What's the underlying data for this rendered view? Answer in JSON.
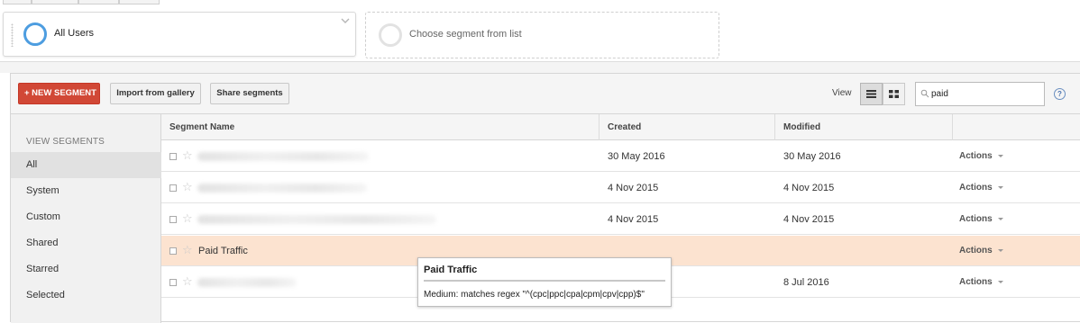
{
  "segments_bar": {
    "selected_segment": "All Users",
    "empty_slot_text": "Choose segment from list"
  },
  "toolbar": {
    "new_segment_label": "+ NEW SEGMENT",
    "import_label": "Import from gallery",
    "share_label": "Share segments",
    "view_label": "View",
    "search_value": "paid",
    "help_label": "?"
  },
  "sidebar": {
    "heading": "VIEW SEGMENTS",
    "items": [
      {
        "label": "All",
        "active": true
      },
      {
        "label": "System"
      },
      {
        "label": "Custom"
      },
      {
        "label": "Shared"
      },
      {
        "label": "Starred"
      },
      {
        "label": "Selected"
      }
    ]
  },
  "table": {
    "headers": {
      "name": "Segment Name",
      "created": "Created",
      "modified": "Modified"
    },
    "rows": [
      {
        "name": "",
        "created": "30 May 2016",
        "modified": "30 May 2016",
        "actions": "Actions"
      },
      {
        "name": "",
        "created": "4 Nov 2015",
        "modified": "4 Nov 2015",
        "actions": "Actions"
      },
      {
        "name": "",
        "created": "4 Nov 2015",
        "modified": "4 Nov 2015",
        "actions": "Actions"
      },
      {
        "name": "Paid Traffic",
        "created": "",
        "modified": "",
        "actions": "Actions",
        "highlighted": true
      },
      {
        "name": "",
        "created": "",
        "modified": "8 Jul 2016",
        "actions": "Actions"
      }
    ]
  },
  "tooltip": {
    "title": "Paid Traffic",
    "body": "Medium: matches regex \"^(cpc|ppc|cpa|cpm|cpv|cpp)$\""
  },
  "colors": {
    "primary_button": "#d14836",
    "ring_selected": "#4d9de0",
    "row_highlight": "#fce3d0"
  },
  "icons": [
    "grip-icon",
    "chevron-down-icon",
    "list-view-icon",
    "grid-view-icon",
    "search-icon",
    "help-icon",
    "star-icon",
    "dropdown-caret-icon"
  ]
}
